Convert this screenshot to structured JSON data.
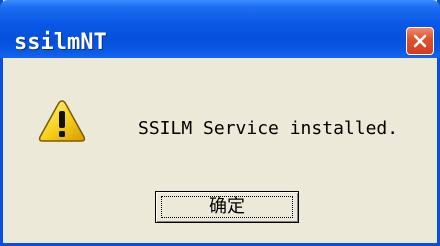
{
  "window": {
    "title": "ssilmNT"
  },
  "dialog": {
    "icon": "warning-icon",
    "message": "SSILM Service installed.",
    "ok_label": "确定"
  },
  "colors": {
    "titlebar": "#0550dc",
    "close_button": "#d23e1e",
    "body": "#ece9d8"
  }
}
